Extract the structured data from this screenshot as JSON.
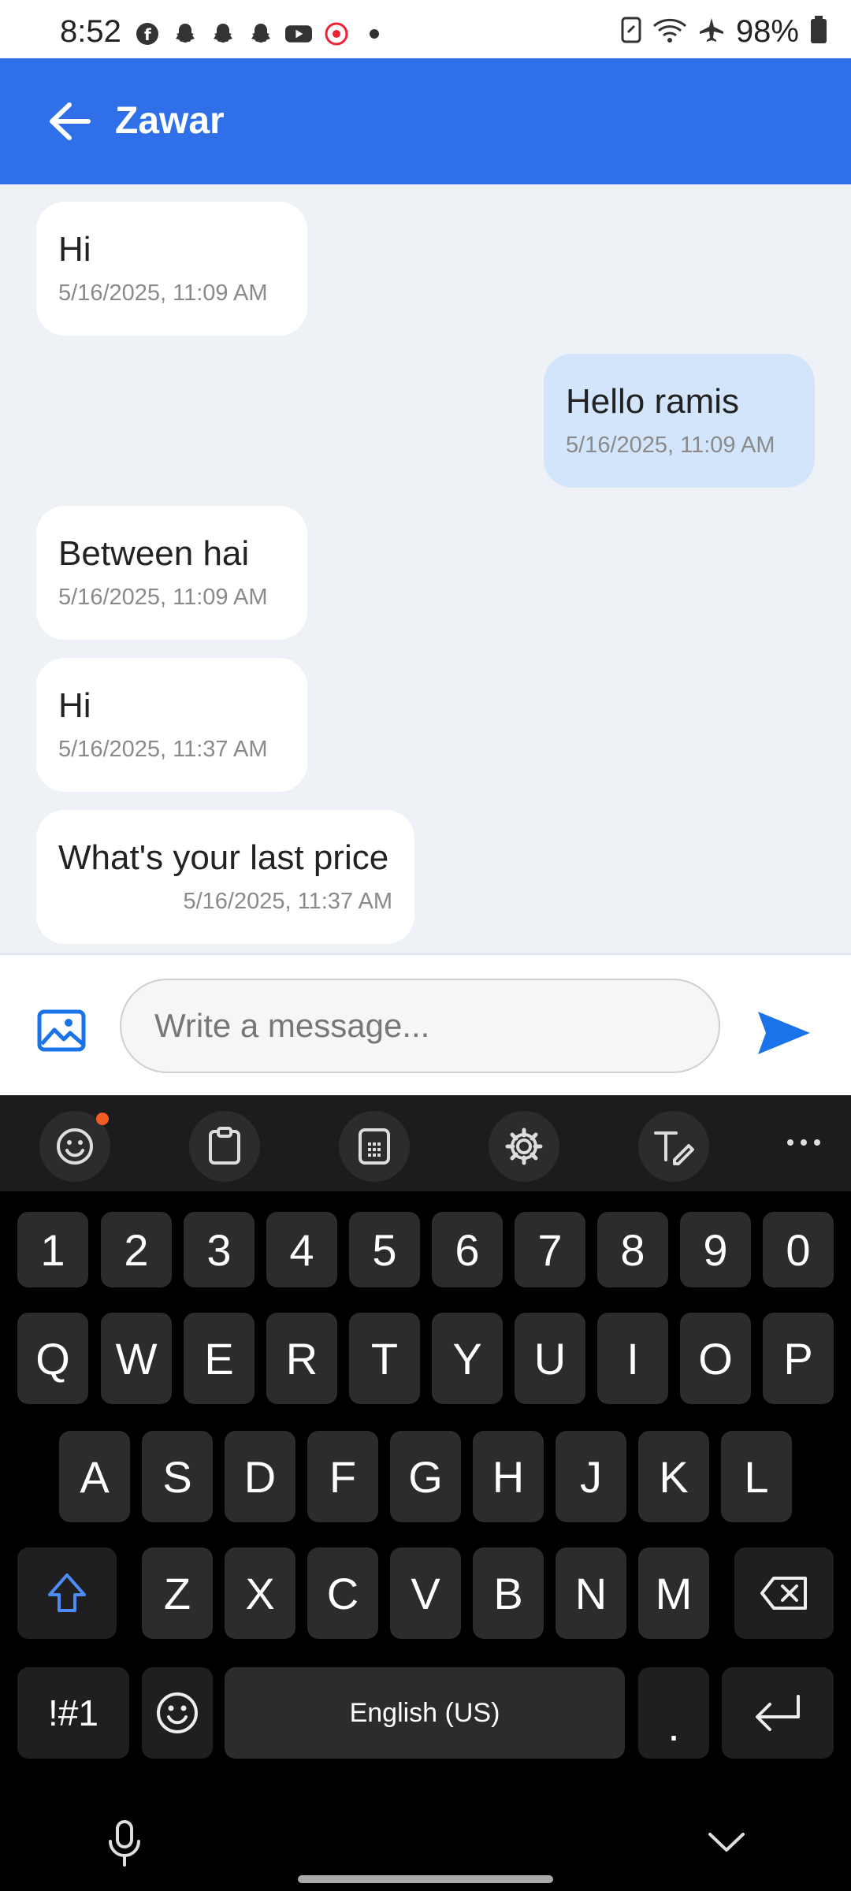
{
  "status_bar": {
    "time": "8:52",
    "battery": "98%"
  },
  "header": {
    "title": "Zawar"
  },
  "messages": [
    {
      "text": "Hi",
      "time": "5/16/2025, 11:09 AM",
      "direction": "in"
    },
    {
      "text": "Hello ramis",
      "time": "5/16/2025, 11:09 AM",
      "direction": "out"
    },
    {
      "text": "Between hai",
      "time": "5/16/2025, 11:09 AM",
      "direction": "in"
    },
    {
      "text": "Hi",
      "time": "5/16/2025, 11:37 AM",
      "direction": "in"
    },
    {
      "text": "What's your last price",
      "time": "5/16/2025, 11:37 AM",
      "direction": "in"
    }
  ],
  "composer": {
    "placeholder": "Write a message..."
  },
  "keyboard": {
    "row_numbers": [
      "1",
      "2",
      "3",
      "4",
      "5",
      "6",
      "7",
      "8",
      "9",
      "0"
    ],
    "row_top": [
      "Q",
      "W",
      "E",
      "R",
      "T",
      "Y",
      "U",
      "I",
      "O",
      "P"
    ],
    "row_mid": [
      "A",
      "S",
      "D",
      "F",
      "G",
      "H",
      "J",
      "K",
      "L"
    ],
    "row_bottom": [
      "Z",
      "X",
      "C",
      "V",
      "B",
      "N",
      "M"
    ],
    "symbols_label": "!#1",
    "space_label": "English (US)",
    "period_label": "."
  },
  "colors": {
    "header": "#2f6fe8",
    "outgoing_bubble": "#d3e5fb",
    "incoming_bubble": "#ffffff",
    "chat_bg": "#eef2f7",
    "send": "#1a73e8"
  }
}
